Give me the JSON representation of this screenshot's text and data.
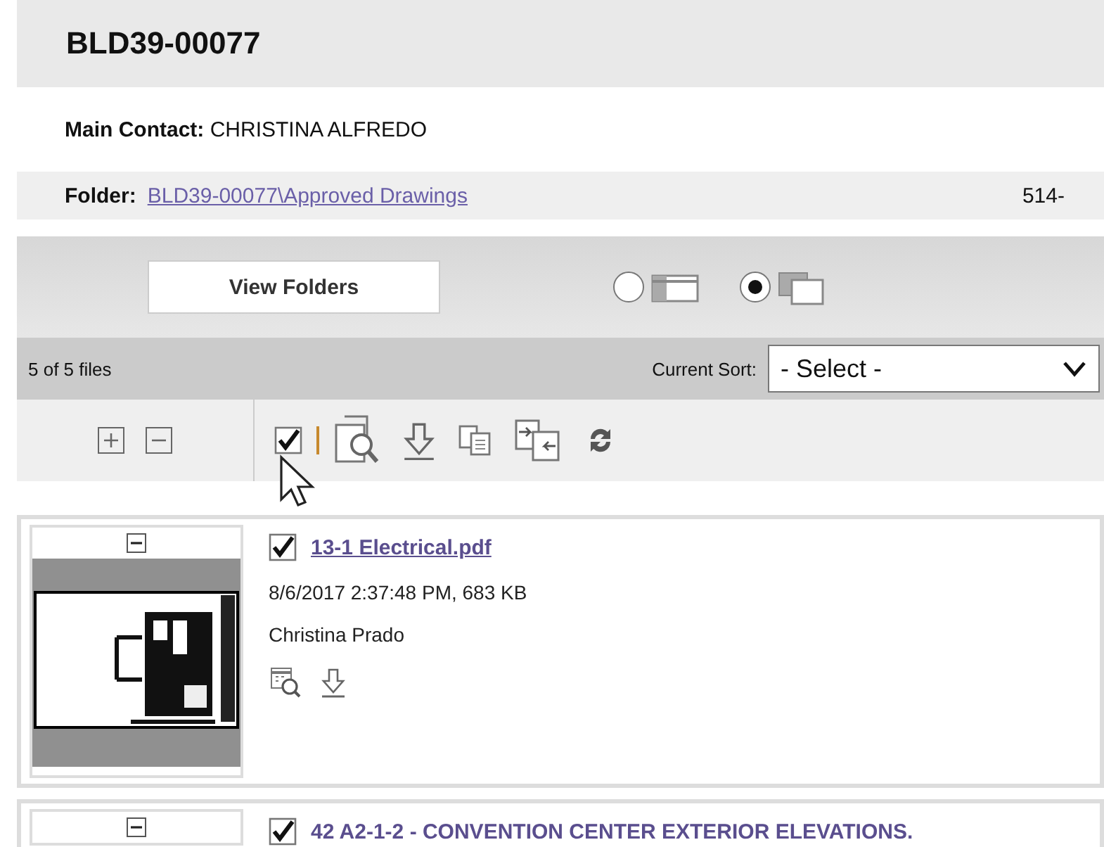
{
  "title": "BLD39-00077",
  "main_contact": {
    "label": "Main Contact:",
    "value": "CHRISTINA ALFREDO"
  },
  "folder": {
    "label": "Folder:",
    "path": "BLD39-00077\\Approved Drawings",
    "extra": "514-"
  },
  "view_folders_button": "View Folders",
  "view_modes": [
    {
      "kind": "list",
      "selected": false
    },
    {
      "kind": "tiles",
      "selected": true
    }
  ],
  "file_count": "5 of 5 files",
  "sort": {
    "label": "Current Sort:",
    "value": "- Select -"
  },
  "select_all": {
    "checked": true
  },
  "files": [
    {
      "name": "13-1 Electrical.pdf",
      "checked": true,
      "meta": "8/6/2017 2:37:48 PM, 683 KB",
      "author": "Christina Prado"
    },
    {
      "name": "42 A2-1-2 - CONVENTION CENTER EXTERIOR ELEVATIONS.",
      "checked": true
    }
  ]
}
